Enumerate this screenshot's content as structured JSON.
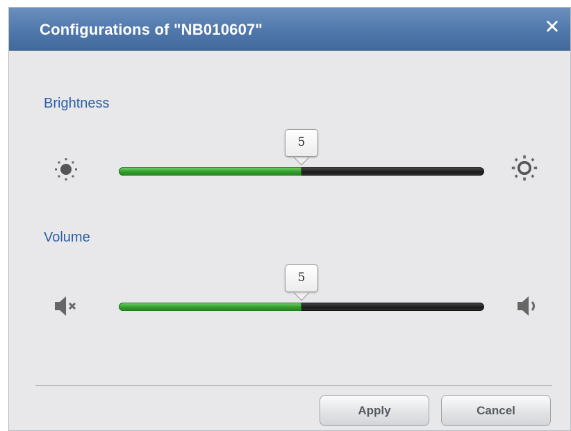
{
  "dialog": {
    "title": "Configurations of \"NB010607\"",
    "close_glyph": "✕"
  },
  "brightness": {
    "label": "Brightness",
    "value": "5",
    "fraction": 0.5,
    "min_icon": "sun-low-icon",
    "max_icon": "sun-high-icon"
  },
  "volume": {
    "label": "Volume",
    "value": "5",
    "fraction": 0.5,
    "min_icon": "volume-mute-icon",
    "max_icon": "volume-high-icon"
  },
  "buttons": {
    "apply": "Apply",
    "cancel": "Cancel"
  },
  "colors": {
    "titlebar": "#4f78ac",
    "label": "#2d5fa6",
    "slider_fill": "#2f9a2a",
    "slider_track": "#1a1a1a"
  }
}
